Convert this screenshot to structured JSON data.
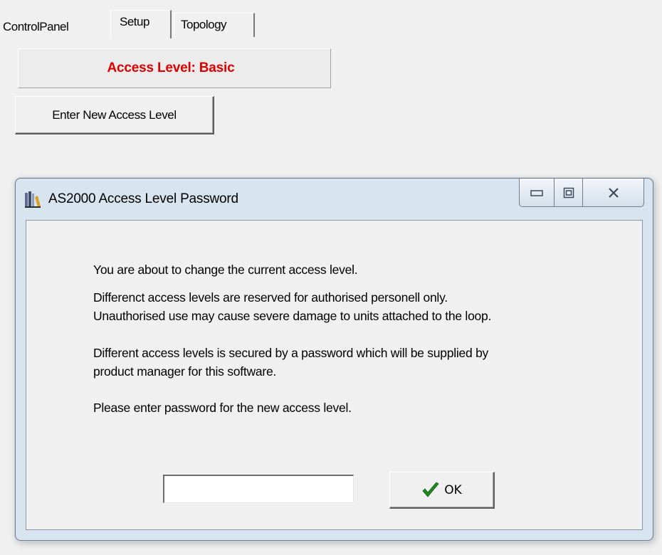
{
  "tabs": [
    {
      "label": "ControlPanel"
    },
    {
      "label": "Setup",
      "active": true
    },
    {
      "label": "Topology"
    }
  ],
  "access_level": {
    "text": "Access Level: Basic",
    "color": "#e00000"
  },
  "enter_button": {
    "label": "Enter New Access Level"
  },
  "dialog": {
    "title": "AS2000 Access Level Password",
    "icon": "books-app-icon",
    "window_controls": [
      "minimize-icon",
      "maximize-icon",
      "close-icon"
    ],
    "message": {
      "line1": "You are about to change the current access level.",
      "line2a": "Differenct access levels are reserved for authorised personell only.",
      "line2b": "Unauthorised use may cause severe damage to units attached to the loop.",
      "line3a": "Different access levels is secured by a password which will be supplied by",
      "line3b": "product manager for this software.",
      "line4": "Please enter  password for the new access level."
    },
    "password": {
      "value": "",
      "placeholder": ""
    },
    "ok_button": {
      "label": "OK",
      "icon": "checkmark-icon",
      "icon_color": "#1e8a1e"
    }
  }
}
